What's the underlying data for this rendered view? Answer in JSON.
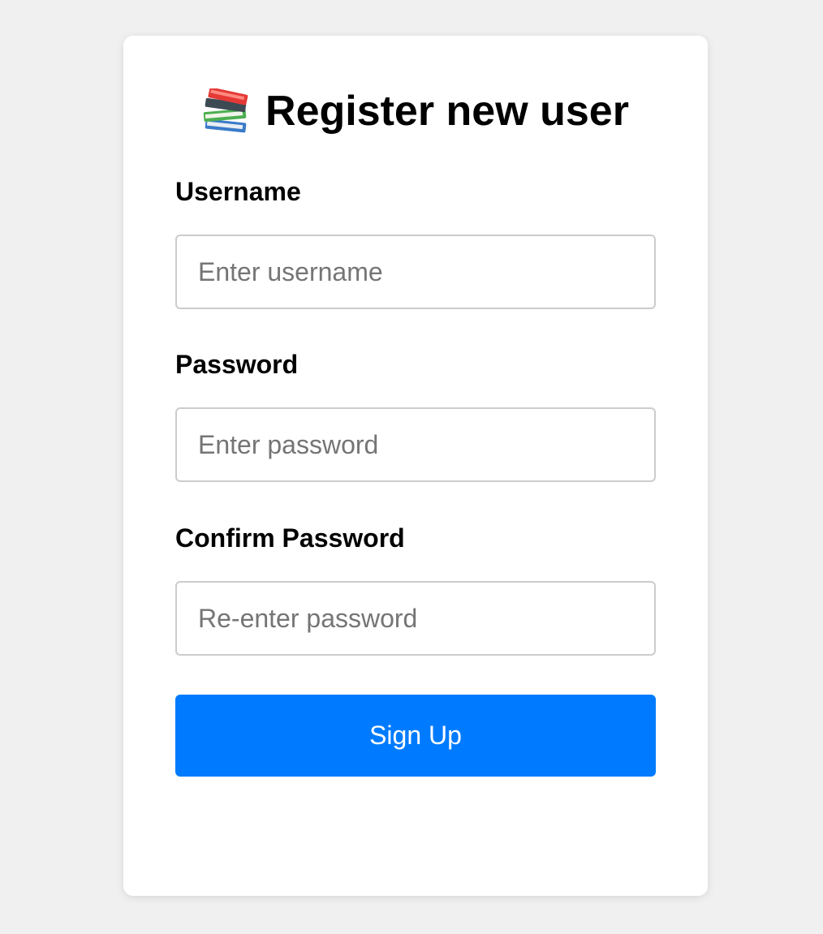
{
  "page": {
    "background": "#f0f0f0",
    "title": "Register new user",
    "title_icon": "books-icon"
  },
  "form": {
    "username": {
      "label": "Username",
      "placeholder": "Enter username",
      "value": ""
    },
    "password": {
      "label": "Password",
      "placeholder": "Enter password",
      "value": ""
    },
    "confirm_password": {
      "label": "Confirm Password",
      "placeholder": "Re-enter password",
      "value": ""
    },
    "submit_label": "Sign Up"
  },
  "colors": {
    "accent": "#007bff",
    "card": "#ffffff",
    "input_border": "#cccccc"
  }
}
